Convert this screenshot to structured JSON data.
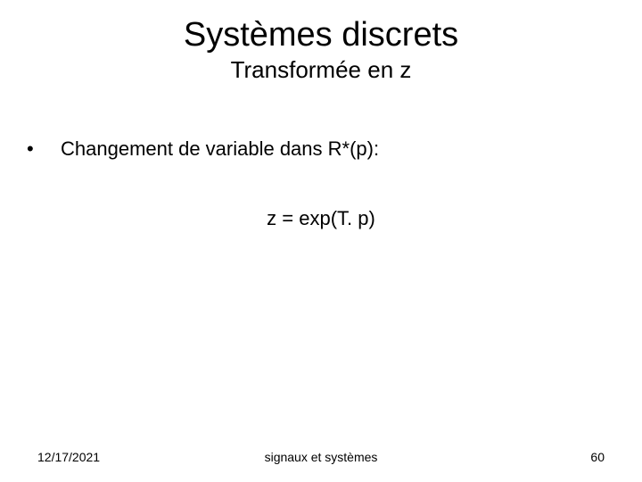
{
  "title": "Systèmes discrets",
  "subtitle": "Transformée en z",
  "bullet": {
    "marker": "•",
    "text": "Changement de variable dans R*(p):"
  },
  "equation": "z = exp(T. p)",
  "footer": {
    "date": "12/17/2021",
    "center": "signaux et systèmes",
    "page": "60"
  }
}
